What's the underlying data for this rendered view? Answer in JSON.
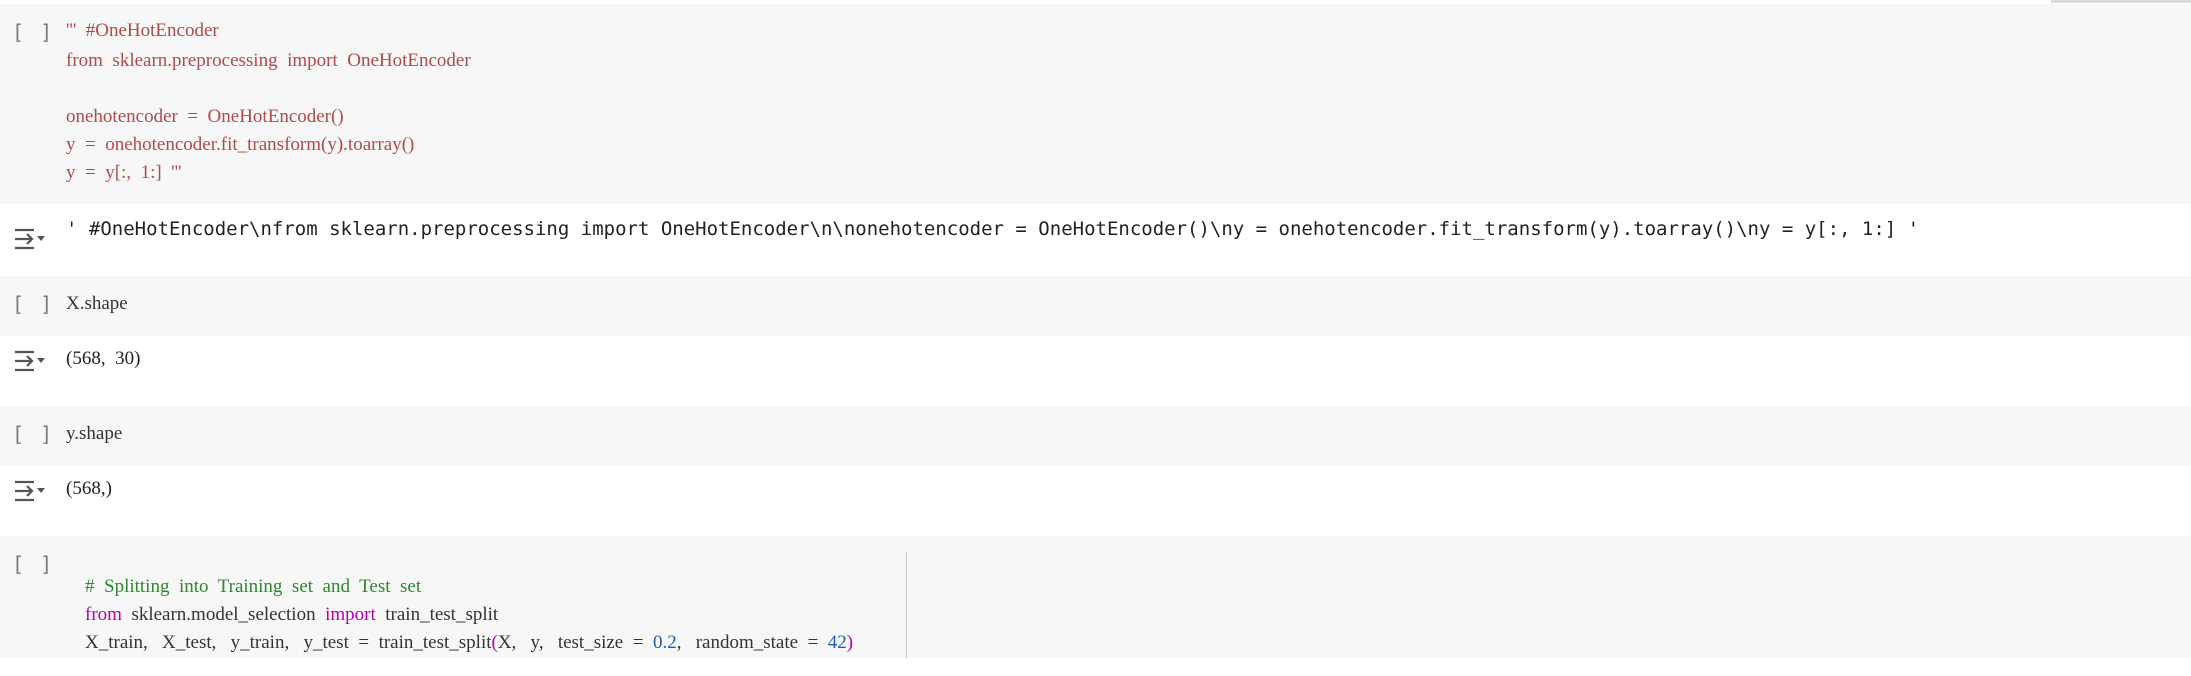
{
  "run_button": "[ ]",
  "cell1": {
    "lines": [
      "'''  #OneHotEncoder",
      "from  sklearn.preprocessing  import  OneHotEncoder",
      "",
      "onehotencoder  =  OneHotEncoder()",
      "y  =  onehotencoder.fit_transform(y).toarray()",
      "y  =  y[:,  1:]  '''"
    ],
    "output": "' #OneHotEncoder\\nfrom sklearn.preprocessing import OneHotEncoder\\n\\nonehotencoder = OneHotEncoder()\\ny = onehotencoder.fit_transform(y).toarray()\\ny = y[:, 1:] '"
  },
  "cell2": {
    "code": "X.shape",
    "output": "(568,  30)"
  },
  "cell3": {
    "code": "y.shape",
    "output": "(568,)"
  },
  "cell4": {
    "comment": "#  Splitting  into  Training  set  and  Test  set",
    "line2": {
      "kw1": "from",
      "mod": "  sklearn.model_selection  ",
      "kw2": "import",
      "name": "  train_test_split"
    },
    "line3": {
      "a": "X_train,   X_test,   y_train,   y_test  =  train_test_split",
      "paren_open": "(",
      "b": "X,   y,   test_size  =  ",
      "n1": "0.2",
      "c": ",   random_state  =  ",
      "n2": "42",
      "paren_close": ")"
    }
  },
  "colors": {
    "string": "#b04a4a",
    "keyword": "#b000b0",
    "comment": "#2a8a2a",
    "number": "#1a5fb4"
  }
}
